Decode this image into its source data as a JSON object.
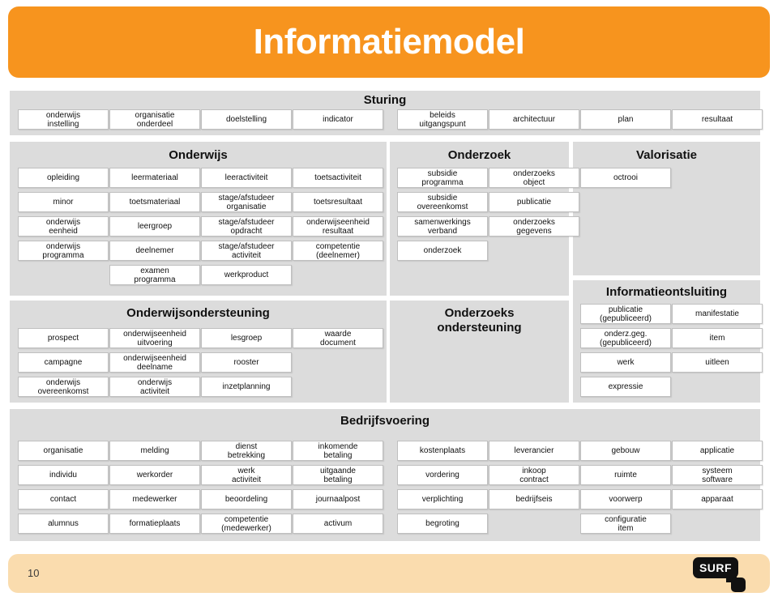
{
  "title": "Informatiemodel",
  "footer": {
    "page_number": "10",
    "logo_text": "SURF"
  },
  "panels": {
    "sturing": {
      "heading": "Sturing",
      "boxes": [
        "onderwijs\ninstelling",
        "organisatie\nonderdeel",
        "doelstelling",
        "indicator",
        "beleids\nuitgangspunt",
        "architectuur",
        "plan",
        "resultaat"
      ]
    },
    "onderwijs": {
      "heading": "Onderwijs",
      "columns": [
        [
          "opleiding",
          "minor",
          "onderwijs\neenheid",
          "onderwijs\nprogramma"
        ],
        [
          "leermateriaal",
          "toetsmateriaal",
          "leergroep",
          "deelnemer",
          "examen\nprogramma"
        ],
        [
          "leeractiviteit",
          "stage/afstudeer\norganisatie",
          "stage/afstudeer\nopdracht",
          "stage/afstudeer\nactiviteit",
          "werkproduct"
        ],
        [
          "toetsactiviteit",
          "toetsresultaat",
          "onderwijseenheid\nresultaat",
          "competentie\n(deelnemer)"
        ]
      ]
    },
    "onderzoek": {
      "heading": "Onderzoek",
      "columns": [
        [
          "subsidie\nprogramma",
          "subsidie\novereenkomst",
          "samenwerkings\nverband",
          "onderzoek"
        ],
        [
          "onderzoeks\nobject",
          "publicatie",
          "onderzoeks\ngegevens"
        ]
      ]
    },
    "valorisatie": {
      "heading": "Valorisatie",
      "columns": [
        [
          "octrooi"
        ]
      ]
    },
    "onderwijsondersteuning": {
      "heading": "Onderwijsondersteuning",
      "columns": [
        [
          "prospect",
          "campagne",
          "onderwijs\novereenkomst"
        ],
        [
          "onderwijseenheid\nuitvoering",
          "onderwijseenheid\ndeelname",
          "onderwijs\nactiviteit"
        ],
        [
          "lesgroep",
          "rooster",
          "inzetplanning"
        ],
        [
          "waarde\ndocument"
        ]
      ]
    },
    "onderzoeksondersteuning": {
      "heading": "Onderzoeks\nondersteuning",
      "columns": []
    },
    "informatieontsluiting": {
      "heading": "Informatieontsluiting",
      "columns": [
        [
          "publicatie\n(gepubliceerd)",
          "onderz.geg.\n(gepubliceerd)",
          "werk",
          "expressie"
        ],
        [
          "manifestatie",
          "item",
          "uitleen"
        ]
      ]
    },
    "bedrijfsvoering": {
      "heading": "Bedrijfsvoering",
      "columns": [
        [
          "organisatie",
          "individu",
          "contact",
          "alumnus"
        ],
        [
          "melding",
          "werkorder",
          "medewerker",
          "formatieplaats"
        ],
        [
          "dienst\nbetrekking",
          "werk\nactiviteit",
          "beoordeling",
          "competentie\n(medewerker)"
        ],
        [
          "inkomende\nbetaling",
          "uitgaande\nbetaling",
          "journaalpost",
          "activum"
        ],
        [
          "kostenplaats",
          "vordering",
          "verplichting",
          "begroting"
        ],
        [
          "leverancier",
          "inkoop\ncontract",
          "bedrijfseis"
        ],
        [
          "gebouw",
          "ruimte",
          "voorwerp",
          "configuratie\nitem"
        ],
        [
          "applicatie",
          "systeem\nsoftware",
          "apparaat"
        ]
      ]
    }
  },
  "colors": {
    "banner": "#F7941E",
    "panel": "#DCDCDC",
    "box": "#FFFFFF",
    "footer": "#FADCAE"
  }
}
